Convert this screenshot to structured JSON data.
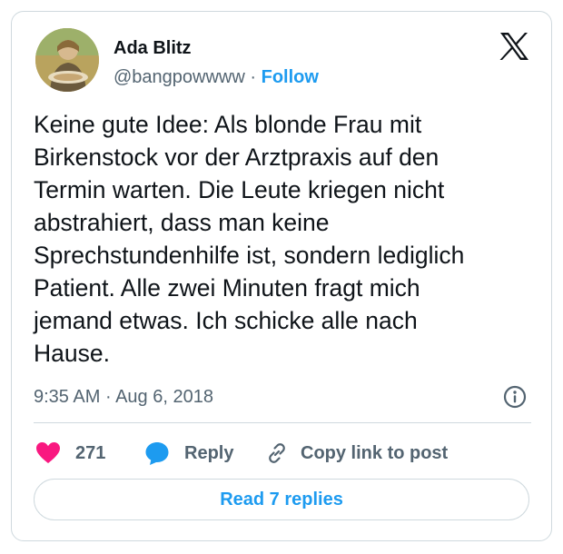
{
  "author": {
    "name": "Ada Blitz",
    "handle": "@bangpowwww",
    "separator": "·",
    "follow_label": "Follow"
  },
  "tweet": {
    "text": "Keine gute Idee: Als blonde Frau mit Birkenstock vor der Arztpraxis auf den Termin warten. Die Leute kriegen nicht abstrahiert, dass man keine Sprechstundenhilfe ist, sondern lediglich Patient. Alle zwei Minuten fragt mich jemand etwas. Ich schicke alle nach Hause.",
    "lines": [
      "Keine gute Idee: Als blonde Frau mit",
      "Birkenstock vor der Arztpraxis auf den",
      "Termin warten. Die Leute kriegen nicht",
      "abstrahiert, dass man keine",
      "Sprechstundenhilfe ist, sondern lediglich",
      "Patient. Alle zwei Minuten fragt mich",
      "jemand etwas. Ich schicke alle nach",
      "Hause."
    ],
    "time": "9:35 AM",
    "date": "Aug 6, 2018",
    "meta_separator": "·"
  },
  "actions": {
    "like_count": "271",
    "reply_label": "Reply",
    "copy_link_label": "Copy link to post",
    "read_replies_label": "Read 7 replies"
  },
  "icons": {
    "logo": "x-logo-icon",
    "info": "info-icon",
    "like": "heart-icon",
    "reply": "speech-bubble-icon",
    "copy": "link-icon"
  },
  "colors": {
    "accent": "#1d9bf0",
    "like": "#f91880",
    "text": "#0f1419",
    "secondary": "#536471",
    "border": "#cfd9de"
  }
}
